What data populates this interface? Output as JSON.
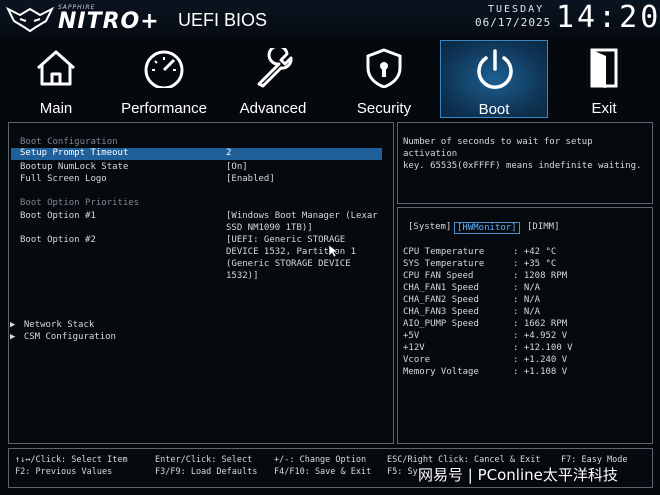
{
  "header": {
    "brand_sub": "SAPPHIRE",
    "brand": "NITRO+",
    "title": "UEFI BIOS",
    "day": "TUESDAY",
    "date": "06/17/2025",
    "time": "14:20"
  },
  "tabs": [
    {
      "label": "Main",
      "icon": "home-icon"
    },
    {
      "label": "Performance",
      "icon": "speedometer-icon"
    },
    {
      "label": "Advanced",
      "icon": "wrench-icon"
    },
    {
      "label": "Security",
      "icon": "shield-lock-icon"
    },
    {
      "label": "Boot",
      "icon": "power-icon",
      "active": true
    },
    {
      "label": "Exit",
      "icon": "exit-door-icon"
    }
  ],
  "boot": {
    "section1": "Boot Configuration",
    "setup_prompt_label": "Setup Prompt Timeout",
    "setup_prompt_value": "2",
    "numlock_label": "Bootup NumLock State",
    "numlock_value": "[On]",
    "logo_label": "Full Screen Logo",
    "logo_value": "[Enabled]",
    "section2": "Boot Option Priorities",
    "opt1_label": "Boot Option #1",
    "opt1_value": [
      "[Windows Boot Manager (Lexar",
      "SSD NM1090 1TB)]"
    ],
    "opt2_label": "Boot Option #2",
    "opt2_value": [
      "[UEFI: Generic STORAGE",
      "DEVICE 1532, Partition 1",
      "(Generic STORAGE DEVICE",
      "1532)]"
    ],
    "network_stack": "Network Stack",
    "csm": "CSM Configuration"
  },
  "help": {
    "line1": "Number of seconds to wait for setup activation",
    "line2": "key. 65535(0xFFFF) means indefinite waiting."
  },
  "hw": {
    "tabs": [
      "[System]",
      "[HWMonitor]",
      "[DIMM]"
    ],
    "rows": [
      {
        "label": "CPU Temperature",
        "value": ": +42 °C"
      },
      {
        "label": "SYS Temperature",
        "value": ": +35 °C"
      },
      {
        "label": "CPU FAN Speed",
        "value": ": 1208 RPM"
      },
      {
        "label": "CHA_FAN1 Speed",
        "value": ": N/A"
      },
      {
        "label": "CHA_FAN2 Speed",
        "value": ": N/A"
      },
      {
        "label": "CHA_FAN3 Speed",
        "value": ": N/A"
      },
      {
        "label": "AIO_PUMP Speed",
        "value": ": 1662 RPM"
      },
      {
        "label": "+5V",
        "value": ": +4.952 V"
      },
      {
        "label": "+12V",
        "value": ": +12.100 V"
      },
      {
        "label": "Vcore",
        "value": ": +1.240 V"
      },
      {
        "label": "Memory Voltage",
        "value": ": +1.108 V"
      }
    ]
  },
  "footer": {
    "c1r1": "↑↓↔/Click: Select Item",
    "c1r2": "F2: Previous Values",
    "c2r1": "Enter/Click: Select",
    "c2r2": "F3/F9: Load Defaults",
    "c3r1": "+/-: Change Option",
    "c3r2": "F4/F10: Save & Exit",
    "c4r1": "ESC/Right Click: Cancel & Exit",
    "c4r2": "F5: Sy",
    "c5r1": "F7: Easy Mode"
  },
  "watermark": "网易号 | PConline太平洋科技",
  "colors": {
    "accent": "#1f5f9a",
    "active_tab": "#1d5f91",
    "border": "#5b6570"
  }
}
